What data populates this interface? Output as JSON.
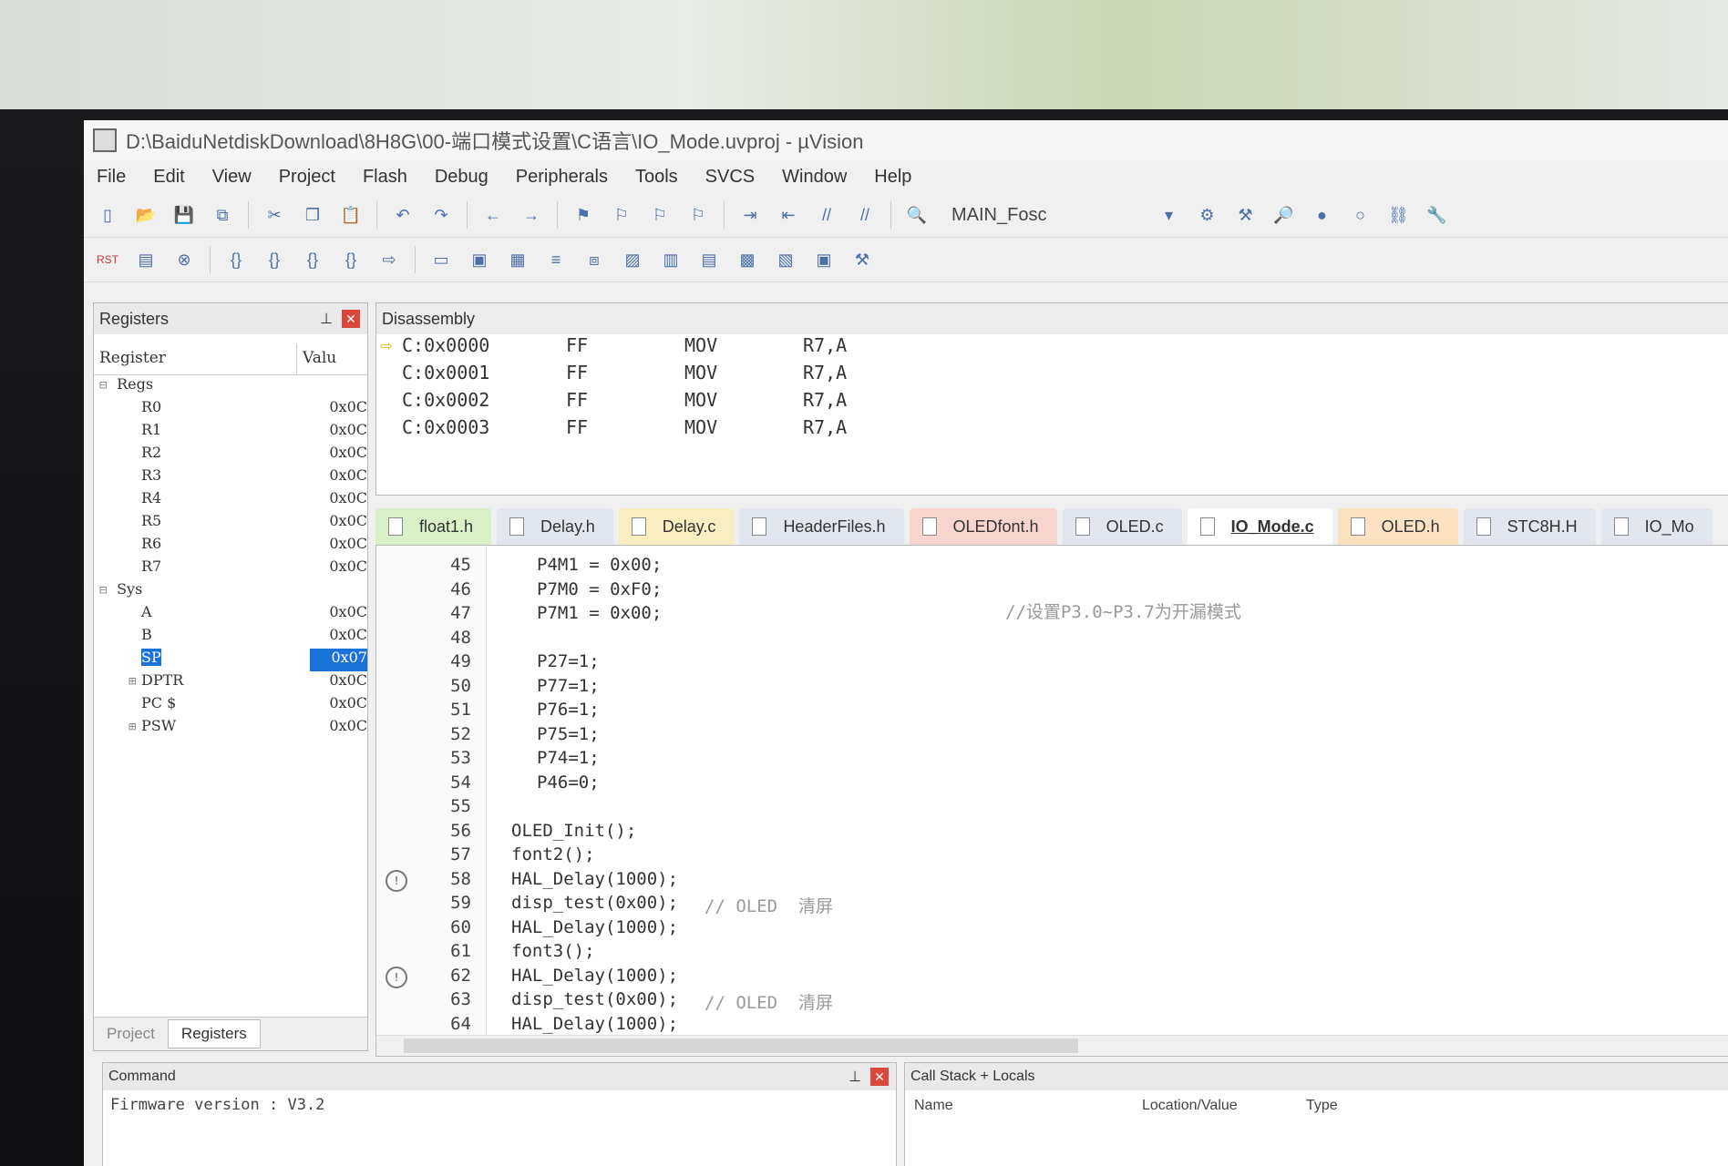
{
  "window": {
    "title": "D:\\BaiduNetdiskDownload\\8H8G\\00-端口模式设置\\C语言\\IO_Mode.uvproj - µVision"
  },
  "menu": [
    "File",
    "Edit",
    "View",
    "Project",
    "Flash",
    "Debug",
    "Peripherals",
    "Tools",
    "SVCS",
    "Window",
    "Help"
  ],
  "toolbar": {
    "target": "MAIN_Fosc",
    "rst_label": "RST"
  },
  "registers_panel": {
    "title": "Registers",
    "col_register": "Register",
    "col_value": "Valu",
    "groups": [
      {
        "label": "Regs",
        "items": [
          {
            "name": "R0",
            "value": "0x0C"
          },
          {
            "name": "R1",
            "value": "0x0C"
          },
          {
            "name": "R2",
            "value": "0x0C"
          },
          {
            "name": "R3",
            "value": "0x0C"
          },
          {
            "name": "R4",
            "value": "0x0C"
          },
          {
            "name": "R5",
            "value": "0x0C"
          },
          {
            "name": "R6",
            "value": "0x0C"
          },
          {
            "name": "R7",
            "value": "0x0C"
          }
        ]
      },
      {
        "label": "Sys",
        "items": [
          {
            "name": "A",
            "value": "0x0C"
          },
          {
            "name": "B",
            "value": "0x0C"
          },
          {
            "name": "SP",
            "value": "0x07",
            "selected": true
          },
          {
            "name": "DPTR",
            "value": "0x0C",
            "expandable": true
          },
          {
            "name": "PC $",
            "value": "0x0C"
          },
          {
            "name": "PSW",
            "value": "0x0C",
            "expandable": true
          }
        ]
      }
    ],
    "tabs": [
      "Project",
      "Registers"
    ]
  },
  "disassembly": {
    "title": "Disassembly",
    "rows": [
      {
        "addr": "C:0x0000",
        "byte": "FF",
        "op": "MOV",
        "args": "R7,A"
      },
      {
        "addr": "C:0x0001",
        "byte": "FF",
        "op": "MOV",
        "args": "R7,A"
      },
      {
        "addr": "C:0x0002",
        "byte": "FF",
        "op": "MOV",
        "args": "R7,A"
      },
      {
        "addr": "C:0x0003",
        "byte": "FF",
        "op": "MOV",
        "args": "R7,A"
      }
    ]
  },
  "file_tabs": [
    {
      "label": "float1.h",
      "color": "green"
    },
    {
      "label": "Delay.h",
      "color": "blue"
    },
    {
      "label": "Delay.c",
      "color": "yellow"
    },
    {
      "label": "HeaderFiles.h",
      "color": "blue"
    },
    {
      "label": "OLEDfont.h",
      "color": "pink"
    },
    {
      "label": "OLED.c",
      "color": "blue"
    },
    {
      "label": "IO_Mode.c",
      "color": "active"
    },
    {
      "label": "OLED.h",
      "color": "orange"
    },
    {
      "label": "STC8H.H",
      "color": "blue"
    },
    {
      "label": "IO_Mo",
      "color": "blue"
    }
  ],
  "editor": {
    "comment_right": "//设置P3.0~P3.7为开漏模式",
    "lines": [
      {
        "n": "45",
        "code": "P4M1 = 0x00;",
        "indent": 1
      },
      {
        "n": "46",
        "code": "P7M0 = 0xF0;",
        "indent": 1
      },
      {
        "n": "47",
        "code": "P7M1 = 0x00;",
        "indent": 1
      },
      {
        "n": "48",
        "code": "",
        "indent": 1
      },
      {
        "n": "49",
        "code": "P27=1;",
        "indent": 1
      },
      {
        "n": "50",
        "code": "P77=1;",
        "indent": 1
      },
      {
        "n": "51",
        "code": "P76=1;",
        "indent": 1
      },
      {
        "n": "52",
        "code": "P75=1;",
        "indent": 1
      },
      {
        "n": "53",
        "code": "P74=1;",
        "indent": 1
      },
      {
        "n": "54",
        "code": "P46=0;",
        "indent": 1
      },
      {
        "n": "55",
        "code": "",
        "indent": 0
      },
      {
        "n": "56",
        "code": "OLED_Init();",
        "indent": 0
      },
      {
        "n": "57",
        "code": "font2();",
        "indent": 0
      },
      {
        "n": "58",
        "code": "HAL_Delay(1000);",
        "indent": 0,
        "bp": true
      },
      {
        "n": "59",
        "code": "disp_test(0x00);",
        "comment": "// OLED  清屏",
        "indent": 0
      },
      {
        "n": "60",
        "code": "HAL_Delay(1000);",
        "indent": 0
      },
      {
        "n": "61",
        "code": "font3();",
        "indent": 0
      },
      {
        "n": "62",
        "code": "HAL_Delay(1000);",
        "indent": 0,
        "bp": true
      },
      {
        "n": "63",
        "code": "disp_test(0x00);",
        "comment": "// OLED  清屏",
        "indent": 0
      },
      {
        "n": "64",
        "code": "HAL_Delay(1000);",
        "indent": 0
      }
    ]
  },
  "command": {
    "title": "Command",
    "text": "Firmware version : V3.2"
  },
  "callstack": {
    "title": "Call Stack + Locals",
    "cols": [
      "Name",
      "Location/Value",
      "Type"
    ]
  }
}
